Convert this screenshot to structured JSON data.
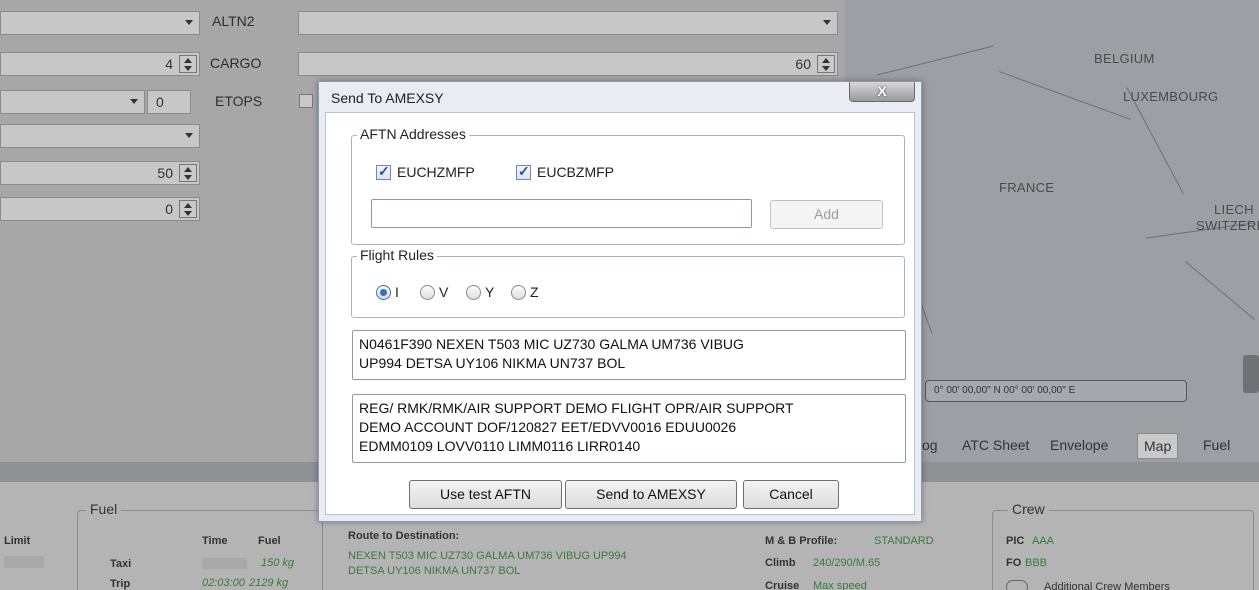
{
  "background_form": {
    "altn2_label": "ALTN2",
    "cargo_label": "CARGO",
    "etops_label": "ETOPS",
    "field_values": {
      "row2_value": "4",
      "cargo_value": "60",
      "row3_value": "0",
      "row5_value": "50",
      "row6_value": "0"
    }
  },
  "map": {
    "countries": [
      "BELGIUM",
      "LUXEMBOURG",
      "FRANCE",
      "LIECH",
      "SWITZERLA"
    ],
    "coord_readout": "0° 00' 00,00\" N 00° 00' 00,00\" E"
  },
  "tabs": [
    {
      "label": "og"
    },
    {
      "label": "ATC Sheet"
    },
    {
      "label": "Envelope"
    },
    {
      "label": "Map",
      "active": true
    },
    {
      "label": "Fuel"
    }
  ],
  "bottom": {
    "limit_label": "Limit",
    "fuel_panel": {
      "title": "Fuel",
      "time_header": "Time",
      "fuel_header": "Fuel",
      "rows": [
        {
          "label": "Taxi",
          "time": "",
          "fuel": "150 kg"
        },
        {
          "label": "Trip",
          "time": "02:03:00",
          "fuel": "2129 kg"
        }
      ]
    },
    "route": {
      "title": "Route to Destination:",
      "text_line1": "NEXEN T503 MIC UZ730 GALMA UM736 VIBUG UP994",
      "text_line2": "DETSA UY106 NIKMA UN737 BOL"
    },
    "profile": {
      "mb_label": "M & B Profile:",
      "mb_value": "STANDARD",
      "climb_label": "Climb",
      "climb_value": "240/290/M.65",
      "cruise_label": "Cruise",
      "cruise_value": "Max speed"
    },
    "crew": {
      "title": "Crew",
      "pic_label": "PIC",
      "pic_value": "AAA",
      "fo_label": "FO",
      "fo_value": "BBB",
      "additional": "Additional Crew Members"
    }
  },
  "dialog": {
    "title": "Send To AMEXSY",
    "close_glyph": "X",
    "aftn": {
      "legend": "AFTN Addresses",
      "addresses": [
        {
          "label": "EUCHZMFP",
          "checked": true
        },
        {
          "label": "EUCBZMFP",
          "checked": true
        }
      ],
      "new_address_value": "",
      "add_label": "Add"
    },
    "flight_rules": {
      "legend": "Flight Rules",
      "options": [
        "I",
        "V",
        "Y",
        "Z"
      ],
      "selected": "I"
    },
    "route_line1": "N0461F390 NEXEN T503 MIC UZ730 GALMA UM736 VIBUG",
    "route_line2": "UP994 DETSA UY106 NIKMA UN737 BOL",
    "remarks_line1": "REG/ RMK/RMK/AIR SUPPORT DEMO FLIGHT OPR/AIR SUPPORT",
    "remarks_line2": "DEMO ACCOUNT DOF/120827 EET/EDVV0016 EDUU0026",
    "remarks_line3": "EDMM0109 LOVV0110 LIMM0116 LIRR0140",
    "buttons": {
      "test_aftn": "Use test AFTN",
      "send": "Send to AMEXSY",
      "cancel": "Cancel"
    }
  },
  "colors": {
    "dialog_bg": "#ffffff",
    "dialog_frame": "#e8ecf3",
    "overlay_gray": "#a7a7a7",
    "radio_selected": "#2f6fd0",
    "green_text": "#3a7a3a"
  }
}
